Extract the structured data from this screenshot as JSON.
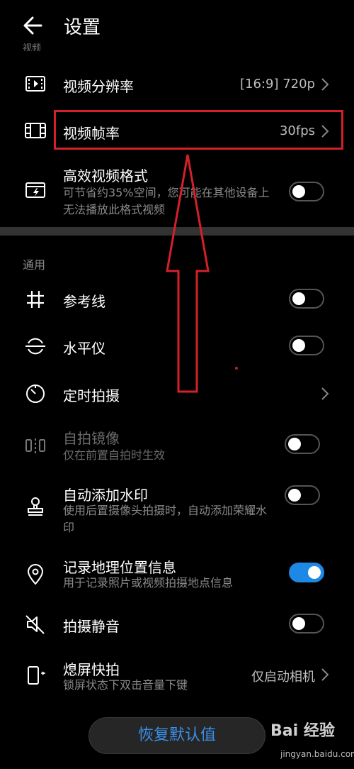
{
  "header": {
    "title": "设置",
    "section_peek": "视频"
  },
  "video": {
    "resolution": {
      "label": "视频分辨率",
      "value": "[16:9] 720p"
    },
    "framerate": {
      "label": "视频帧率",
      "value": "30fps"
    },
    "efficient": {
      "label": "高效视频格式",
      "sub": "可节省约35%空间，您可能在其他设备上无法播放此格式视频",
      "on": false
    }
  },
  "general": {
    "section_label": "通用",
    "gridlines": {
      "label": "参考线",
      "on": false
    },
    "level": {
      "label": "水平仪",
      "on": false
    },
    "timer": {
      "label": "定时拍摄"
    },
    "mirror": {
      "label": "自拍镜像",
      "sub": "仅在前置自拍时生效",
      "on": false
    },
    "watermark": {
      "label": "自动添加水印",
      "sub": "使用后置摄像头拍摄时，自动添加荣耀水印",
      "on": false
    },
    "location": {
      "label": "记录地理位置信息",
      "sub": "用于记录照片或视频拍摄地点信息",
      "on": true
    },
    "mute": {
      "label": "拍摄静音",
      "on": false
    },
    "ultra_snapshot": {
      "label": "熄屏快拍",
      "sub": "锁屏状态下双击音量下键",
      "value": "仅启动相机"
    }
  },
  "reset_label": "恢复默认值",
  "watermark_overlay": {
    "logo": "Bai 经验",
    "url": "jingyan.baidu.com"
  },
  "colors": {
    "accent": "#1e88e5",
    "annotation": "#d4202a",
    "reset_text": "#3a8ee6"
  }
}
